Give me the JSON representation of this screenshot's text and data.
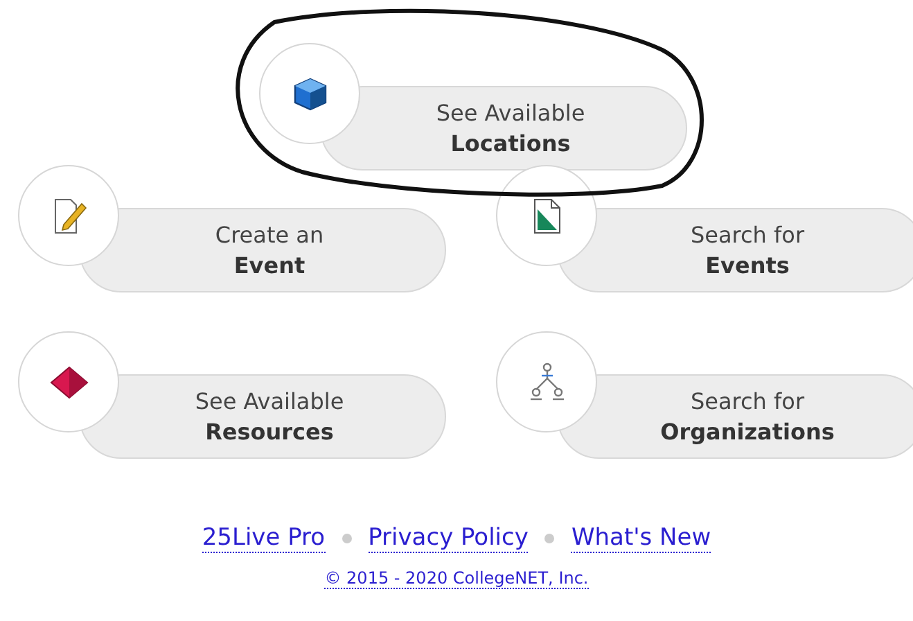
{
  "tiles": [
    {
      "line1": "See Available",
      "line2": "Locations"
    },
    {
      "line1": "Create an",
      "line2": "Event"
    },
    {
      "line1": "Search for",
      "line2": "Events"
    },
    {
      "line1": "See Available",
      "line2": "Resources"
    },
    {
      "line1": "Search for",
      "line2": "Organizations"
    }
  ],
  "footer_links": [
    "25Live Pro",
    "Privacy Policy",
    "What's New"
  ],
  "copyright": "© 2015 - 2020 CollegeNET, Inc."
}
